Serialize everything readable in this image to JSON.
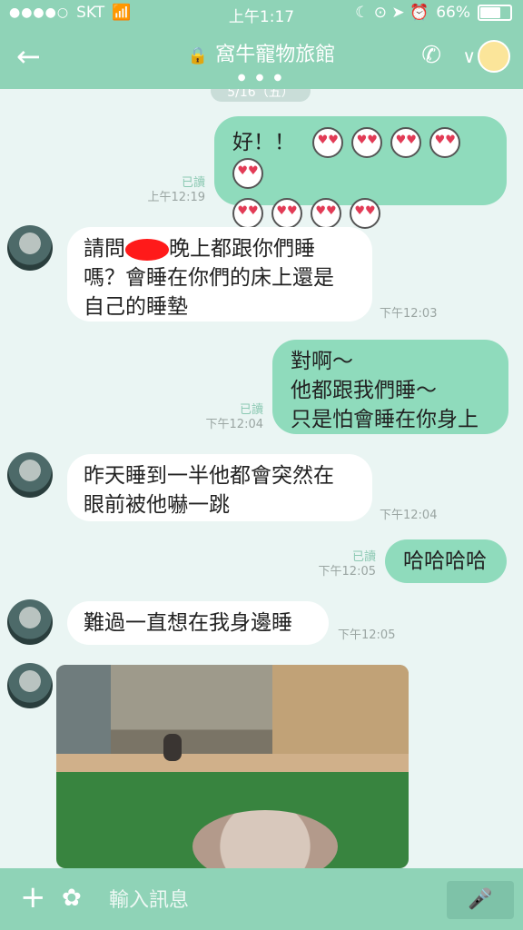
{
  "status": {
    "dots": "●●●●○",
    "carrier": "SKT",
    "wifi": "📶",
    "time": "上午1:17",
    "icons": "☾ ⊙ ➤ ⏰",
    "battery": "66%",
    "battery_fraction": 0.66
  },
  "header": {
    "back": "←",
    "lock": "🔒",
    "title": "窩牛寵物旅館",
    "pager": "● ● ●",
    "phone": "✆",
    "chevron": "∨"
  },
  "chat": {
    "date": "5/16（五）",
    "messages": [
      {
        "side": "out",
        "text": "好！！",
        "emoji_count": 9,
        "emoji": "♥♥",
        "read": "已讀",
        "time": "上午12:19"
      },
      {
        "side": "in",
        "lines": [
          "請問",
          "晚上都跟你們睡",
          "嗎？會睡在你們的床上還是",
          "自己的睡墊"
        ],
        "time": "下午12:03"
      },
      {
        "side": "out",
        "lines": [
          "對啊～",
          "他都跟我們睡～",
          "只是怕會睡在你身上"
        ],
        "read": "已讀",
        "time": "下午12:04"
      },
      {
        "side": "in",
        "lines": [
          "昨天睡到一半他都會突然在",
          "眼前被他嚇一跳"
        ],
        "time": "下午12:04"
      },
      {
        "side": "out",
        "text": "哈哈哈哈",
        "read": "已讀",
        "time": "下午12:05"
      },
      {
        "side": "in",
        "text": "難過一直想在我身邊睡",
        "time": "下午12:05"
      }
    ]
  },
  "input": {
    "plus": "+",
    "sticker": "✿",
    "placeholder": "輸入訊息",
    "mic": "🎤"
  }
}
